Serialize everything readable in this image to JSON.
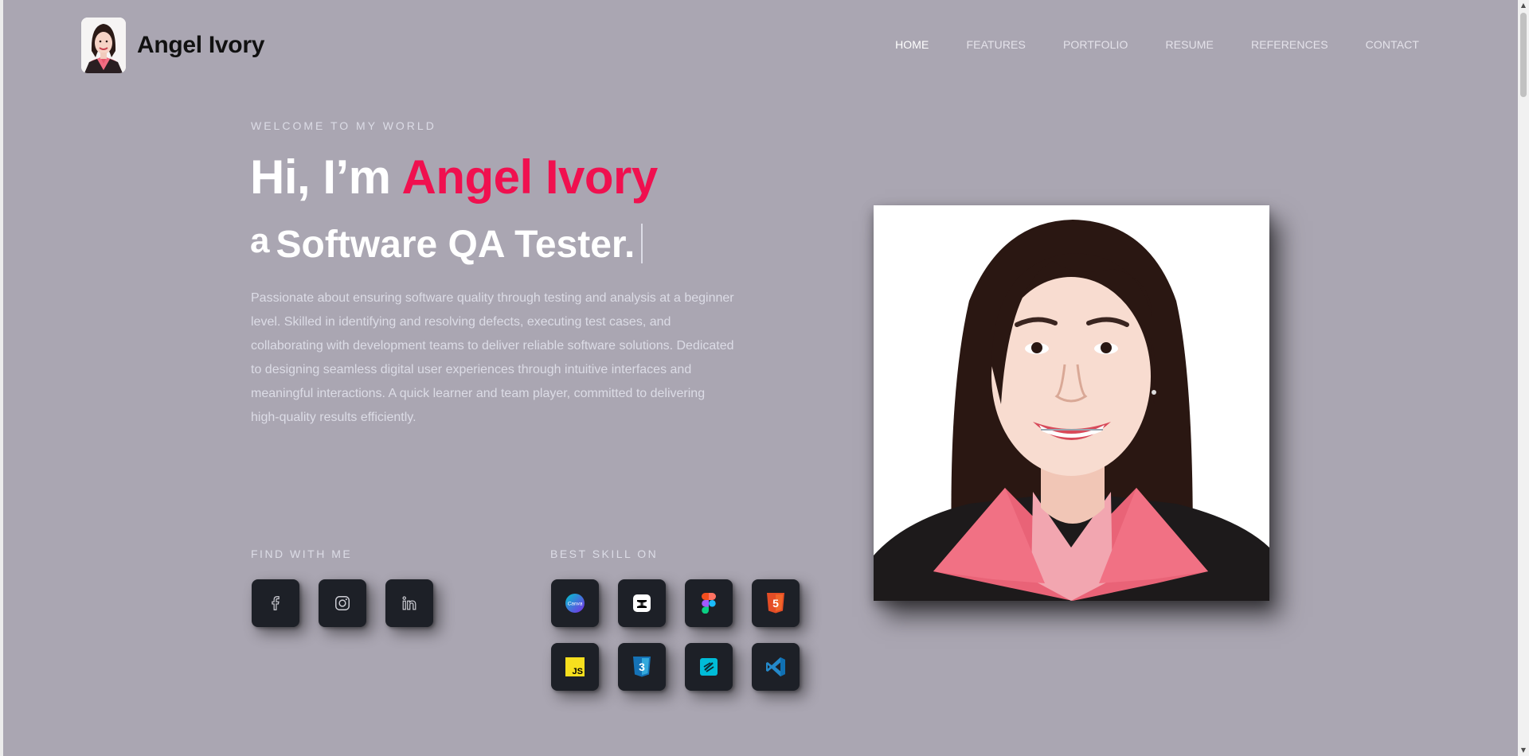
{
  "brand": {
    "name": "Angel Ivory",
    "avatar_alt": "profile photo"
  },
  "nav": {
    "items": [
      "HOME",
      "FEATURES",
      "PORTFOLIO",
      "RESUME",
      "REFERENCES",
      "CONTACT"
    ],
    "active": "HOME"
  },
  "hero": {
    "welcome": "WELCOME TO MY WORLD",
    "greeting": "Hi, I’m",
    "name": "Angel Ivory",
    "role_prefix": "a",
    "role": "Software QA Tester.",
    "description": "Passionate about ensuring software quality through testing and analysis at a beginner level. Skilled in identifying and resolving defects, executing test cases, and collaborating with development teams to deliver reliable software solutions. Dedicated to designing seamless digital user experiences through intuitive interfaces and meaningful interactions. A quick learner and team player, committed to delivering high-quality results efficiently."
  },
  "find_with_me": {
    "label": "FIND WITH ME",
    "icons": [
      "facebook-icon",
      "instagram-icon",
      "linkedin-icon"
    ]
  },
  "best_skill_on": {
    "label": "BEST SKILL ON",
    "icons": [
      "canva-icon",
      "capcut-icon",
      "figma-icon",
      "html5-icon",
      "javascript-icon",
      "css3-icon",
      "swagger-icon",
      "vscode-icon"
    ],
    "canva_text": "Canva",
    "html_text": "5",
    "css_text": "3",
    "js_text": "JS"
  },
  "colors": {
    "background": "#aaa6b2",
    "accent": "#f0104f",
    "tile": "#1d2027",
    "nav_text": "#e4e2ea"
  }
}
